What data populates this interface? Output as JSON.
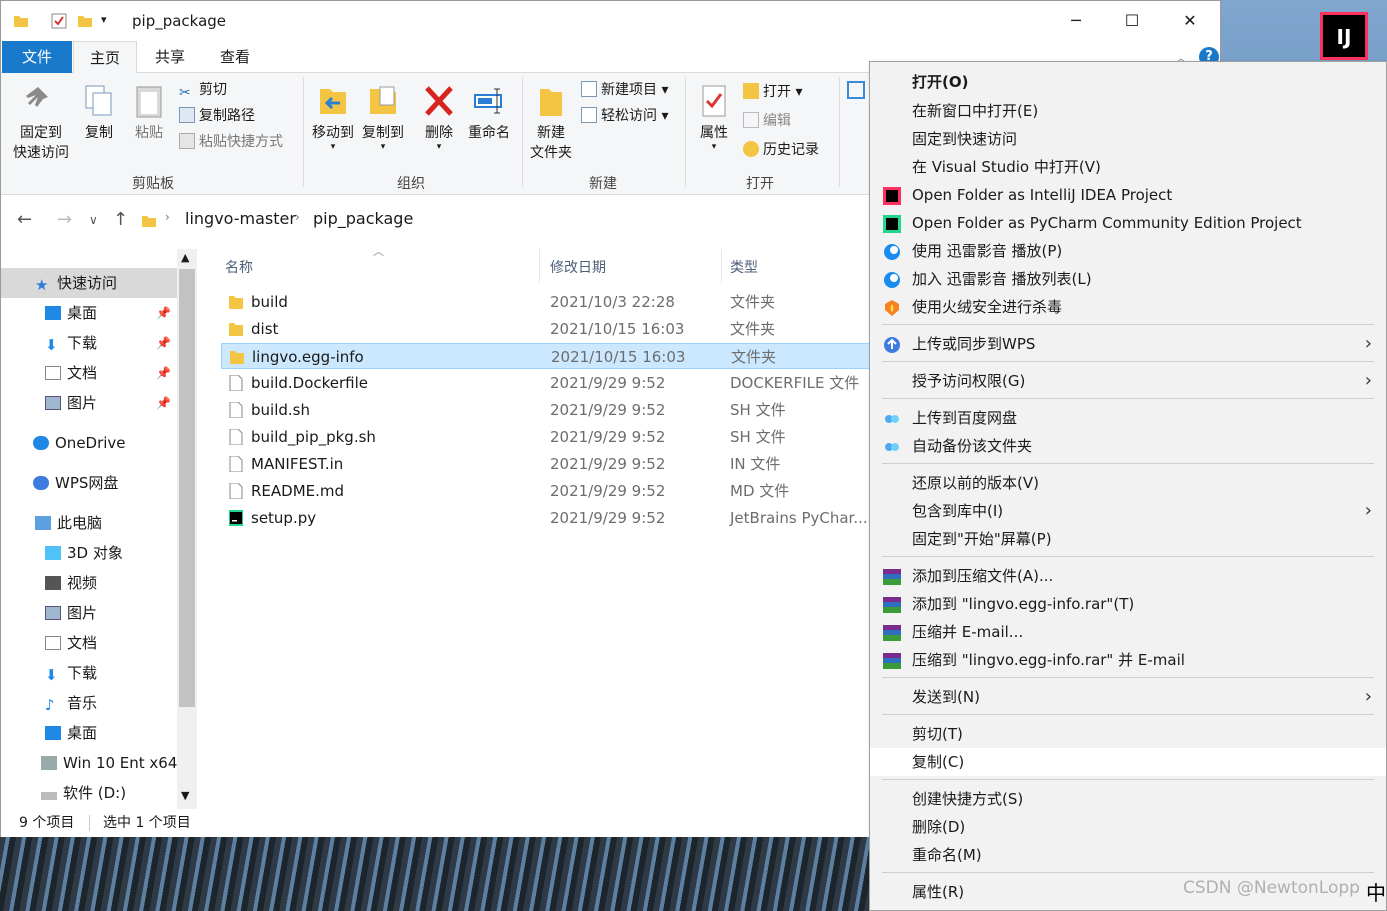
{
  "window": {
    "title": "pip_package",
    "minimize": "─",
    "maximize": "☐",
    "close": "✕",
    "help": "?"
  },
  "tabs": [
    "文件",
    "主页",
    "共享",
    "查看"
  ],
  "ribbon": {
    "pin_l1": "固定到",
    "pin_l2": "快速访问",
    "copy": "复制",
    "paste": "粘贴",
    "cut": "剪切",
    "copy_path": "复制路径",
    "paste_shortcut": "粘贴快捷方式",
    "group_clipboard": "剪贴板",
    "move_to": "移动到",
    "copy_to": "复制到",
    "delete": "删除",
    "rename": "重命名",
    "group_organize": "组织",
    "new_folder_l1": "新建",
    "new_folder_l2": "文件夹",
    "new_item": "新建项目",
    "easy_access": "轻松访问",
    "group_new": "新建",
    "properties": "属性",
    "open": "打开",
    "edit": "编辑",
    "history": "历史记录",
    "group_open": "打开"
  },
  "address": {
    "crumbs": [
      "lingvo-master",
      "pip_package"
    ]
  },
  "nav": [
    {
      "label": "快速访问",
      "icon": "star-icon",
      "pinned": false
    },
    {
      "label": "桌面",
      "icon": "desktop-icon",
      "pinned": true
    },
    {
      "label": "下载",
      "icon": "download-icon",
      "pinned": true
    },
    {
      "label": "文档",
      "icon": "document-icon",
      "pinned": true
    },
    {
      "label": "图片",
      "icon": "picture-icon",
      "pinned": true
    },
    {
      "label": "OneDrive",
      "icon": "cloud-icon",
      "pinned": false
    },
    {
      "label": "WPS网盘",
      "icon": "cloud-icon",
      "pinned": false
    },
    {
      "label": "此电脑",
      "icon": "computer-icon",
      "pinned": false
    },
    {
      "label": "3D 对象",
      "icon": "cube-icon",
      "pinned": false
    },
    {
      "label": "视频",
      "icon": "video-icon",
      "pinned": false
    },
    {
      "label": "图片",
      "icon": "picture-icon",
      "pinned": false
    },
    {
      "label": "文档",
      "icon": "document-icon",
      "pinned": false
    },
    {
      "label": "下载",
      "icon": "download-icon",
      "pinned": false
    },
    {
      "label": "音乐",
      "icon": "music-icon",
      "pinned": false
    },
    {
      "label": "桌面",
      "icon": "desktop-icon",
      "pinned": false
    },
    {
      "label": "Win 10 Ent x64",
      "icon": "network-drive-icon",
      "pinned": false
    },
    {
      "label": "软件 (D:)",
      "icon": "drive-icon",
      "pinned": false
    }
  ],
  "columns": {
    "name": "名称",
    "date": "修改日期",
    "type": "类型"
  },
  "files": [
    {
      "name": "build",
      "date": "2021/10/3 22:28",
      "type": "文件夹",
      "icon": "folder-icon"
    },
    {
      "name": "dist",
      "date": "2021/10/15 16:03",
      "type": "文件夹",
      "icon": "folder-icon"
    },
    {
      "name": "lingvo.egg-info",
      "date": "2021/10/15 16:03",
      "type": "文件夹",
      "icon": "folder-icon",
      "selected": true
    },
    {
      "name": "build.Dockerfile",
      "date": "2021/9/29 9:52",
      "type": "DOCKERFILE 文件",
      "icon": "file-icon"
    },
    {
      "name": "build.sh",
      "date": "2021/9/29 9:52",
      "type": "SH 文件",
      "icon": "file-icon"
    },
    {
      "name": "build_pip_pkg.sh",
      "date": "2021/9/29 9:52",
      "type": "SH 文件",
      "icon": "file-icon"
    },
    {
      "name": "MANIFEST.in",
      "date": "2021/9/29 9:52",
      "type": "IN 文件",
      "icon": "file-icon"
    },
    {
      "name": "README.md",
      "date": "2021/9/29 9:52",
      "type": "MD 文件",
      "icon": "file-icon"
    },
    {
      "name": "setup.py",
      "date": "2021/9/29 9:52",
      "type": "JetBrains PyChar...",
      "icon": "pycharm-icon"
    }
  ],
  "status": {
    "count": "9 个项目",
    "selected": "选中 1 个项目"
  },
  "context_menu": [
    {
      "label": "打开(O)",
      "bold": true
    },
    {
      "label": "在新窗口中打开(E)"
    },
    {
      "label": "固定到快速访问"
    },
    {
      "label": "在 Visual Studio 中打开(V)"
    },
    {
      "label": "Open Folder as IntelliJ IDEA Project",
      "icon": "intellij-icon"
    },
    {
      "label": "Open Folder as PyCharm Community Edition Project",
      "icon": "pycharm-icon"
    },
    {
      "label": "使用 迅雷影音 播放(P)",
      "icon": "xunlei-icon"
    },
    {
      "label": "加入 迅雷影音 播放列表(L)",
      "icon": "xunlei-icon"
    },
    {
      "label": "使用火绒安全进行杀毒",
      "icon": "huorong-icon"
    },
    {
      "sep": true
    },
    {
      "label": "上传或同步到WPS",
      "icon": "wps-cloud-icon",
      "sub": true
    },
    {
      "sep": true
    },
    {
      "label": "授予访问权限(G)",
      "sub": true
    },
    {
      "sep": true
    },
    {
      "label": "上传到百度网盘",
      "icon": "baidu-icon"
    },
    {
      "label": "自动备份该文件夹",
      "icon": "baidu-icon"
    },
    {
      "sep": true
    },
    {
      "label": "还原以前的版本(V)"
    },
    {
      "label": "包含到库中(I)",
      "sub": true
    },
    {
      "label": "固定到\"开始\"屏幕(P)"
    },
    {
      "sep": true
    },
    {
      "label": "添加到压缩文件(A)...",
      "icon": "winrar-icon"
    },
    {
      "label": "添加到 \"lingvo.egg-info.rar\"(T)",
      "icon": "winrar-icon"
    },
    {
      "label": "压缩并 E-mail...",
      "icon": "winrar-icon"
    },
    {
      "label": "压缩到 \"lingvo.egg-info.rar\" 并 E-mail",
      "icon": "winrar-icon"
    },
    {
      "sep": true
    },
    {
      "label": "发送到(N)",
      "sub": true
    },
    {
      "sep": true
    },
    {
      "label": "剪切(T)"
    },
    {
      "label": "复制(C)",
      "highlighted": true
    },
    {
      "sep": true
    },
    {
      "label": "创建快捷方式(S)"
    },
    {
      "label": "删除(D)"
    },
    {
      "label": "重命名(M)"
    },
    {
      "sep": true
    },
    {
      "label": "属性(R)"
    }
  ],
  "watermark": "CSDN @NewtonLopp",
  "ime": "中",
  "desktop": {
    "ij_badge": "IJ"
  },
  "colors": {
    "accent": "#1979ca",
    "selection": "#cce8ff",
    "menu_bg": "#f2f2f2",
    "folder": "#f4c542"
  }
}
